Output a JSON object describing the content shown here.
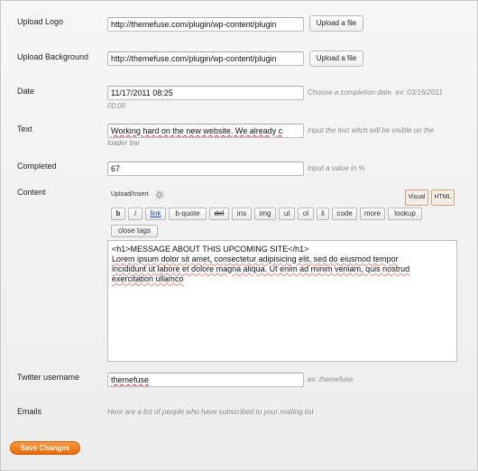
{
  "fields": {
    "upload_logo": {
      "label": "Upload Logo",
      "value": "http://themefuse.com/plugin/wp-content/plugin",
      "button": "Upload a file"
    },
    "upload_background": {
      "label": "Upload Background",
      "value": "http://themefuse.com/plugin/wp-content/plugin",
      "button": "Upload a file"
    },
    "date": {
      "label": "Date",
      "value": "11/17/2011 08:25",
      "hint_line1": "Choose a completion date. ex: 03/16/2011",
      "hint_line2": "00:00"
    },
    "text": {
      "label": "Text",
      "value": "Working hard on the new website. We already c",
      "hint_line1": "Input the text witch will be visible on the",
      "hint_line2": "loader bar"
    },
    "completed": {
      "label": "Completed",
      "value": "67",
      "hint": "Input a value in %"
    },
    "content": {
      "label": "Content",
      "upload_insert": "Upload/Insert",
      "visual_tab": "Visual",
      "html_tab": "HTML",
      "toolbar": [
        "b",
        "i",
        "link",
        "b-quote",
        "del",
        "ins",
        "img",
        "ul",
        "ol",
        "li",
        "code",
        "more",
        "lookup"
      ],
      "close_tags": "close tags",
      "body_line1": "<h1>MESSAGE ABOUT THIS UPCOMING SITE</h1>",
      "body_line2": "Lorem ipsum dolor sit amet, consectetur adipisicing elit, sed do eiusmod tempor",
      "body_line3": "incididunt ut labore et dolore magna aliqua. Ut enim ad minim veniam, quis nostrud",
      "body_line4": "exercitation ullamco"
    },
    "twitter": {
      "label": "Twitter username",
      "value": "themefuse",
      "hint": "ex. themefuse"
    },
    "emails": {
      "label": "Emails",
      "hint": "Here are a list of people who have subscribed to your mailing list"
    }
  },
  "save_button": "Save Changes",
  "colors": {
    "accent": "#f07f1c",
    "tab_border": "#d2a27c",
    "spell_underline": "#dd3333"
  }
}
